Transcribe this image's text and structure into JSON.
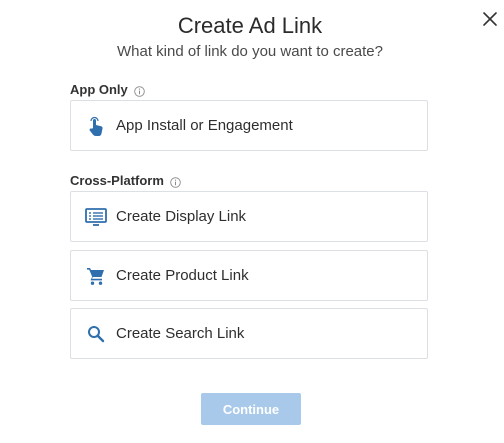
{
  "modal": {
    "title": "Create Ad Link",
    "subtitle": "What kind of link do you want to create?",
    "close_icon": "close-icon"
  },
  "sections": {
    "app_only": {
      "label": "App Only",
      "info_icon": "info-icon",
      "options": [
        {
          "label": "App Install or Engagement",
          "icon": "tap-hand-icon"
        }
      ]
    },
    "cross_platform": {
      "label": "Cross-Platform",
      "info_icon": "info-icon",
      "options": [
        {
          "label": "Create Display Link",
          "icon": "display-ad-icon"
        },
        {
          "label": "Create Product Link",
          "icon": "shopping-cart-icon"
        },
        {
          "label": "Create Search Link",
          "icon": "search-icon"
        }
      ]
    }
  },
  "actions": {
    "continue_label": "Continue"
  },
  "colors": {
    "icon_blue": "#2f6fad",
    "continue_disabled_bg": "#a9c9ea",
    "border": "#dcdfe3"
  }
}
